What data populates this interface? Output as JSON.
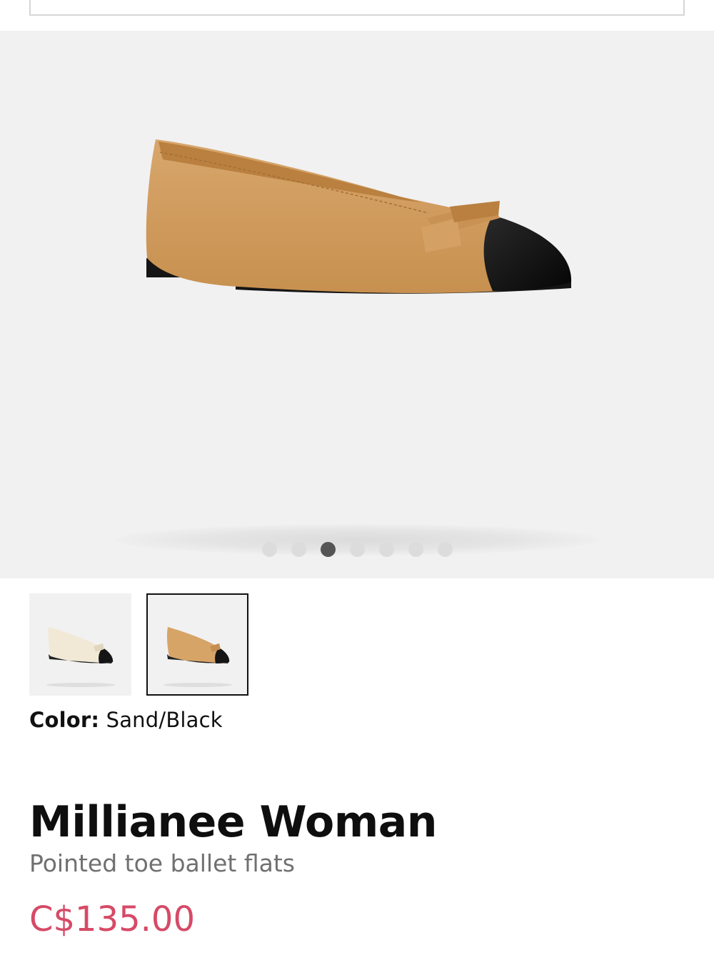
{
  "gallery": {
    "dot_count": 7,
    "active_index": 2,
    "image_alt": "Sand/Black pointed toe ballet flat"
  },
  "thumbnails": [
    {
      "name": "Chalk/Black",
      "selected": false,
      "upper_color": "#f1e9d6"
    },
    {
      "name": "Sand/Black",
      "selected": true,
      "upper_color": "#d7a468"
    }
  ],
  "color": {
    "label": "Color:",
    "value": "Sand/Black"
  },
  "product": {
    "title": "Millianee Woman",
    "subtitle": "Pointed toe ballet flats",
    "price": "C$135.00"
  },
  "colors": {
    "price": "#d64a66",
    "upper": "#d7a468",
    "toe": "#141414"
  }
}
